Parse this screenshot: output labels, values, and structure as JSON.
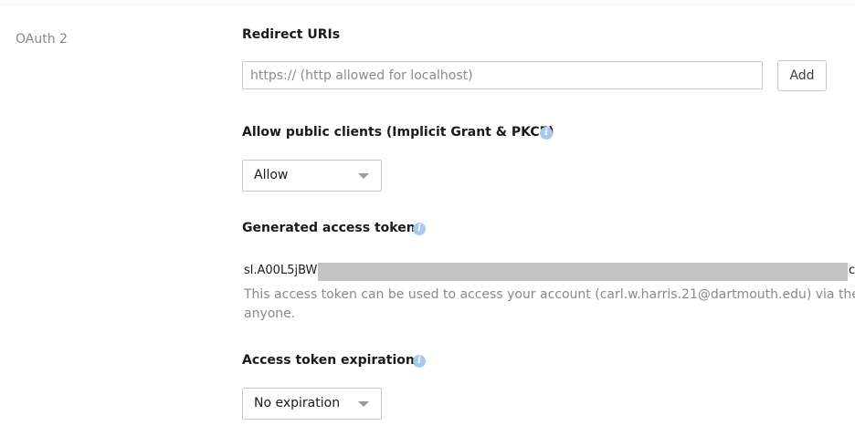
{
  "section": {
    "label": "OAuth 2"
  },
  "redirect_uris": {
    "title": "Redirect URIs",
    "placeholder": "https:// (http allowed for localhost)",
    "value": "",
    "add_label": "Add"
  },
  "public_clients": {
    "title": "Allow public clients (Implicit Grant & PKCE)",
    "info_icon": "info-icon",
    "selected": "Allow"
  },
  "access_token": {
    "title": "Generated access token",
    "info_icon": "info-icon",
    "token_prefix": "sl.A00L5jBW",
    "token_suffix": "c",
    "description_line1": "This access token can be used to access your account (carl.w.harris.21@dartmouth.edu) via the A",
    "description_line2": "anyone."
  },
  "expiration": {
    "title": "Access token expiration",
    "info_icon": "info-icon",
    "selected": "No expiration"
  },
  "colors": {
    "label_gray": "#8a8a8a",
    "info_blue": "#a9c8ee",
    "border": "#c8c8c8",
    "redaction": "#c3c3c3"
  }
}
